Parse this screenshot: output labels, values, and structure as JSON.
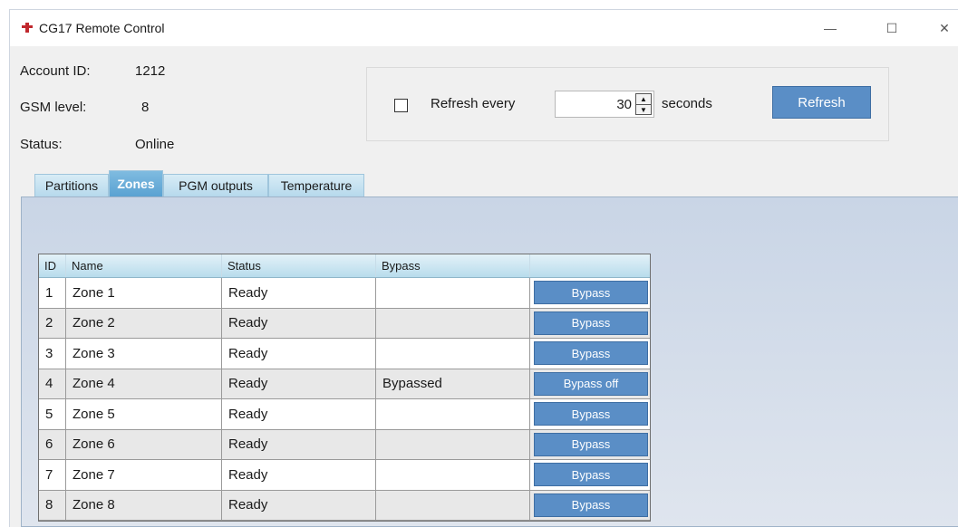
{
  "window": {
    "title": "CG17 Remote Control",
    "controls": {
      "minimize": "—",
      "maximize": "☐",
      "close": "✕"
    }
  },
  "info": {
    "account_label": "Account ID:",
    "account_value": "1212",
    "gsm_label": "GSM level:",
    "gsm_value": "8",
    "status_label": "Status:",
    "status_value": "Online"
  },
  "refresh": {
    "checkbox_checked": false,
    "label": "Refresh every",
    "interval": "30",
    "unit": "seconds",
    "button": "Refresh"
  },
  "tabs": [
    {
      "label": "Partitions",
      "active": false
    },
    {
      "label": "Zones",
      "active": true
    },
    {
      "label": "PGM outputs",
      "active": false
    },
    {
      "label": "Temperature",
      "active": false
    }
  ],
  "zones_table": {
    "headers": [
      "ID",
      "Name",
      "Status",
      "Bypass",
      ""
    ],
    "rows": [
      {
        "id": "1",
        "name": "Zone 1",
        "status": "Ready",
        "bypass": "",
        "action": "Bypass"
      },
      {
        "id": "2",
        "name": "Zone 2",
        "status": "Ready",
        "bypass": "",
        "action": "Bypass"
      },
      {
        "id": "3",
        "name": "Zone 3",
        "status": "Ready",
        "bypass": "",
        "action": "Bypass"
      },
      {
        "id": "4",
        "name": "Zone 4",
        "status": "Ready",
        "bypass": "Bypassed",
        "action": "Bypass off"
      },
      {
        "id": "5",
        "name": "Zone 5",
        "status": "Ready",
        "bypass": "",
        "action": "Bypass"
      },
      {
        "id": "6",
        "name": "Zone 6",
        "status": "Ready",
        "bypass": "",
        "action": "Bypass"
      },
      {
        "id": "7",
        "name": "Zone 7",
        "status": "Ready",
        "bypass": "",
        "action": "Bypass"
      },
      {
        "id": "8",
        "name": "Zone 8",
        "status": "Ready",
        "bypass": "",
        "action": "Bypass"
      }
    ]
  },
  "colors": {
    "accent_button": "#5a8ec6",
    "active_tab": "#5aa2d2",
    "tab": "#b6d9ec",
    "panel": "#c9d5e6",
    "app_icon": "#c0282d"
  },
  "icons": {
    "app": "app-icon",
    "checkbox": "checkbox",
    "spin_up": "▲",
    "spin_down": "▼"
  }
}
